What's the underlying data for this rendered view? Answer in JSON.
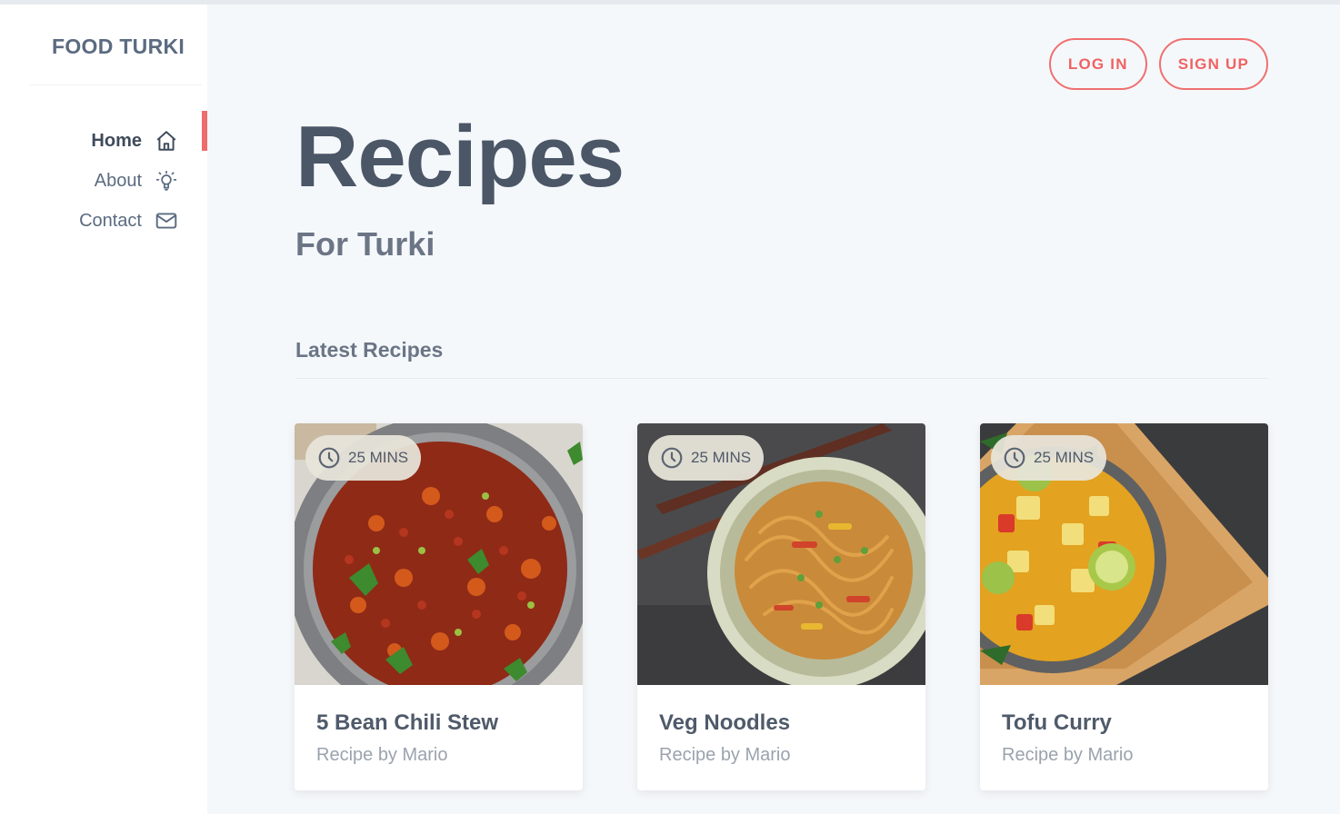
{
  "brand": "FOOD TURKI",
  "nav": {
    "items": [
      {
        "label": "Home",
        "icon": "home-icon",
        "active": true
      },
      {
        "label": "About",
        "icon": "lightbulb-icon",
        "active": false
      },
      {
        "label": "Contact",
        "icon": "mail-icon",
        "active": false
      }
    ]
  },
  "header": {
    "login_label": "LOG IN",
    "signup_label": "SIGN UP"
  },
  "hero": {
    "title": "Recipes",
    "subtitle": "For Turki"
  },
  "latest": {
    "heading": "Latest Recipes",
    "recipes": [
      {
        "title": "5 Bean Chili Stew",
        "author": "Recipe by Mario",
        "time": "25 MINS",
        "image": "chili-stew-photo"
      },
      {
        "title": "Veg Noodles",
        "author": "Recipe by Mario",
        "time": "25 MINS",
        "image": "veg-noodles-photo"
      },
      {
        "title": "Tofu Curry",
        "author": "Recipe by Mario",
        "time": "25 MINS",
        "image": "tofu-curry-photo"
      }
    ]
  },
  "colors": {
    "accent": "#f06b6b",
    "text_dark": "#4b5667",
    "background": "#f5f8fb",
    "sidebar": "#ffffff"
  }
}
